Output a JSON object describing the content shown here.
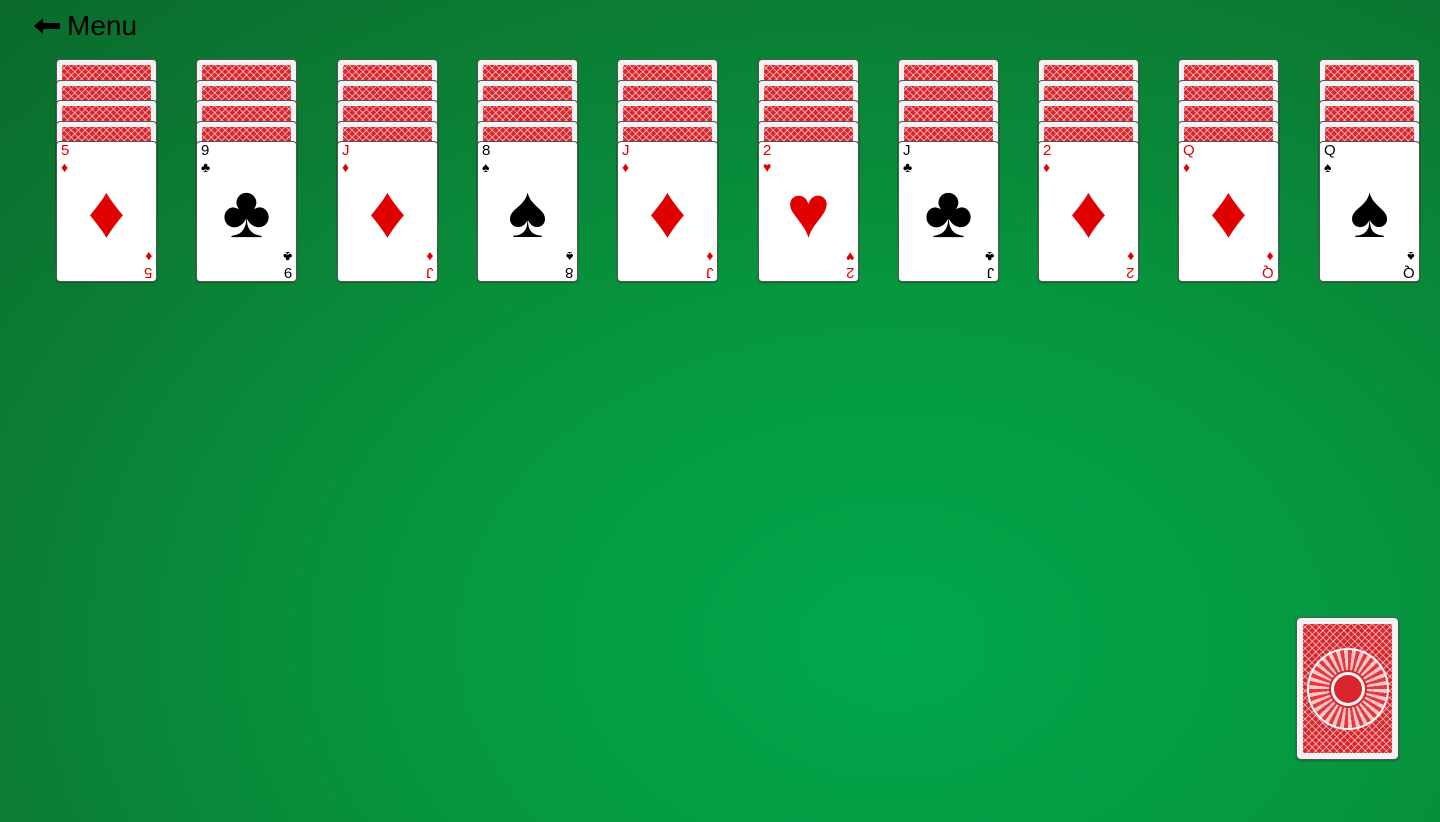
{
  "menu": {
    "label": "Menu",
    "icon": "arrow-left-icon"
  },
  "colors": {
    "table_green": "#0b8a3a",
    "card_red": "#e10000",
    "card_back_red": "#d9262c"
  },
  "tableau": [
    {
      "facedown_count": 4,
      "top_card": {
        "rank": "5",
        "suit": "diamonds",
        "symbol": "♦",
        "color": "red"
      }
    },
    {
      "facedown_count": 4,
      "top_card": {
        "rank": "9",
        "suit": "clubs",
        "symbol": "♣",
        "color": "black"
      }
    },
    {
      "facedown_count": 4,
      "top_card": {
        "rank": "J",
        "suit": "diamonds",
        "symbol": "♦",
        "color": "red"
      }
    },
    {
      "facedown_count": 4,
      "top_card": {
        "rank": "8",
        "suit": "spades",
        "symbol": "♠",
        "color": "black"
      }
    },
    {
      "facedown_count": 4,
      "top_card": {
        "rank": "J",
        "suit": "diamonds",
        "symbol": "♦",
        "color": "red"
      }
    },
    {
      "facedown_count": 4,
      "top_card": {
        "rank": "2",
        "suit": "hearts",
        "symbol": "♥",
        "color": "red"
      }
    },
    {
      "facedown_count": 4,
      "top_card": {
        "rank": "J",
        "suit": "clubs",
        "symbol": "♣",
        "color": "black"
      }
    },
    {
      "facedown_count": 4,
      "top_card": {
        "rank": "2",
        "suit": "diamonds",
        "symbol": "♦",
        "color": "red"
      }
    },
    {
      "facedown_count": 4,
      "top_card": {
        "rank": "Q",
        "suit": "diamonds",
        "symbol": "♦",
        "color": "red"
      }
    },
    {
      "facedown_count": 4,
      "top_card": {
        "rank": "Q",
        "suit": "spades",
        "symbol": "♠",
        "color": "black"
      }
    }
  ],
  "stock": {
    "state": "face-down"
  }
}
